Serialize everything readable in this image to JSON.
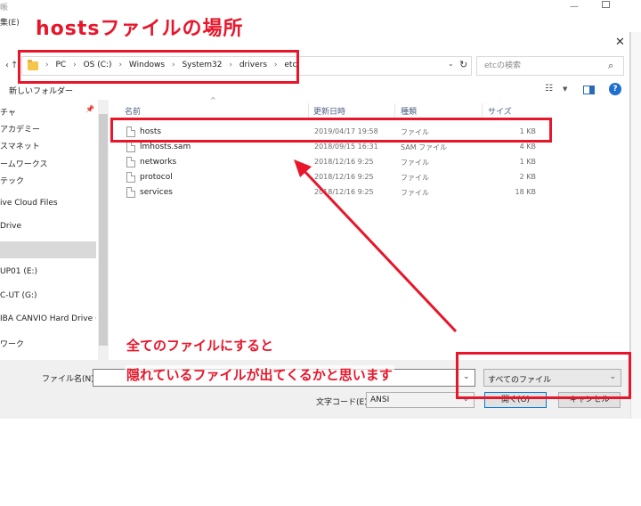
{
  "annotations": {
    "title": "hostsファイルの場所",
    "note_line1": "全てのファイルにすると",
    "note_line2": "隠れているファイルが出てくるかと思います",
    "color": "#e8162a"
  },
  "background_window": {
    "title": "帳",
    "menu": "集(E)"
  },
  "address_bar": {
    "crumbs": [
      "PC",
      "OS (C:)",
      "Windows",
      "System32",
      "drivers",
      "etc"
    ]
  },
  "search": {
    "placeholder": "etcの検索"
  },
  "toolbar": {
    "new_folder_label": "新しいフォルダー"
  },
  "nav_pane": {
    "items": [
      {
        "label": "チャ"
      },
      {
        "label": "アカデミー"
      },
      {
        "label": "スマネット"
      },
      {
        "label": "ームワークス"
      },
      {
        "label": "テック"
      },
      {
        "label": "ive Cloud Files"
      },
      {
        "label": "Drive"
      },
      {
        "label": ""
      },
      {
        "label": "UP01 (E:)"
      },
      {
        "label": "C-UT (G:)"
      },
      {
        "label": "IBA CANVIO Hard Drive ("
      },
      {
        "label": "ワーク"
      }
    ]
  },
  "columns": {
    "name": "名前",
    "date": "更新日時",
    "type": "種類",
    "size": "サイズ"
  },
  "files": [
    {
      "name": "hosts",
      "date": "2019/04/17 19:58",
      "type": "ファイル",
      "size": "1 KB"
    },
    {
      "name": "lmhosts.sam",
      "date": "2018/09/15 16:31",
      "type": "SAM ファイル",
      "size": "4 KB"
    },
    {
      "name": "networks",
      "date": "2018/12/16 9:25",
      "type": "ファイル",
      "size": "1 KB"
    },
    {
      "name": "protocol",
      "date": "2018/12/16 9:25",
      "type": "ファイル",
      "size": "2 KB"
    },
    {
      "name": "services",
      "date": "2018/12/16 9:25",
      "type": "ファイル",
      "size": "18 KB"
    }
  ],
  "bottom": {
    "filename_label": "ファイル名(N):",
    "filename_value": "",
    "filetype_value": "すべてのファイル",
    "encoding_label": "文字コード(E):",
    "encoding_value": "ANSI",
    "open_label": "開く(O)",
    "cancel_label": "キャンセル"
  }
}
